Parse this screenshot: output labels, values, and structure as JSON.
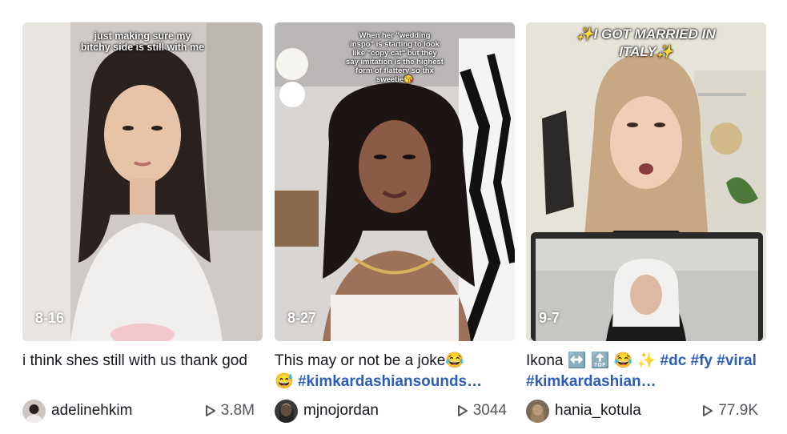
{
  "videos": [
    {
      "caption": "just making sure my\nbitchy side is still with me",
      "date": "8-16",
      "description_text": "i think shes still with us thank god",
      "description_tags": "",
      "username": "adelinehkim",
      "views": "3.8M"
    },
    {
      "caption": "When her \"wedding\ninspo\" is starting to look\nlike \"copy cat\" but they\nsay imitation is the highest\nform of flattery so thx\nsweetie😘",
      "date": "8-27",
      "description_text": "This may or not be a joke😂\n😅 ",
      "description_tags": "#kimkardashiansounds…",
      "username": "mjnojordan",
      "views": "3044"
    },
    {
      "caption": "✨I GOT MARRIED IN\nITALY✨",
      "date": "9-7",
      "description_text": "Ikona ↔️ 🔝 😂 ✨ ",
      "description_tags": "#dc #fy #viral #kimkardashian…",
      "username": "hania_kotula",
      "views": "77.9K"
    }
  ]
}
